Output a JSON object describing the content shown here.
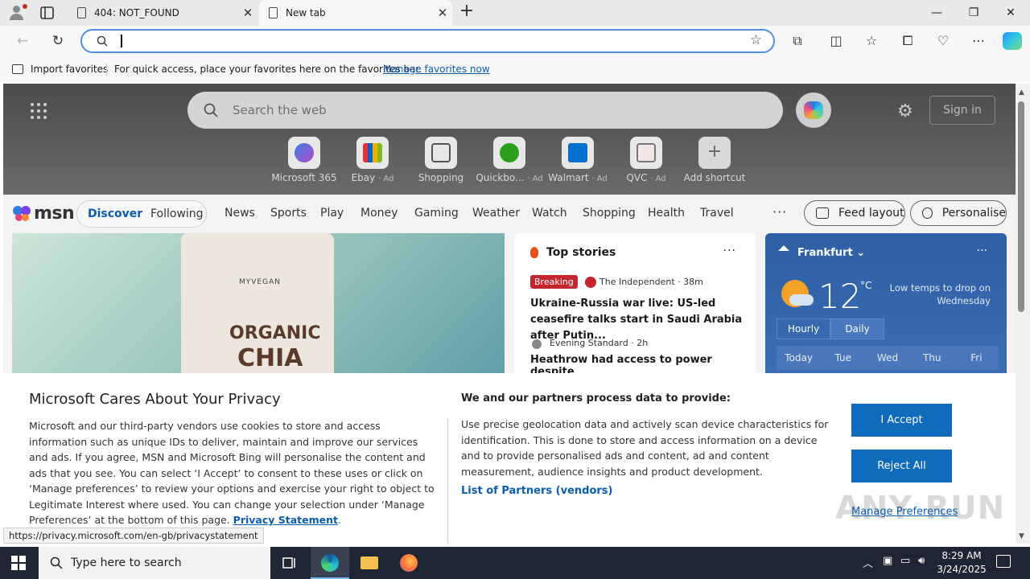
{
  "browser": {
    "tabs": [
      {
        "title": "404: NOT_FOUND",
        "active": false
      },
      {
        "title": "New tab",
        "active": true
      }
    ],
    "address": {
      "value": "",
      "placeholder": ""
    },
    "favorites_bar": {
      "import_label": "Import favorites",
      "hint": "For quick access, place your favorites here on the favorites bar.",
      "manage_link": "Manage favorites now"
    }
  },
  "msn": {
    "search_placeholder": "Search the web",
    "sign_in": "Sign in",
    "shortcuts": [
      {
        "label": "Microsoft 365",
        "ad": ""
      },
      {
        "label": "Ebay",
        "ad": "· Ad"
      },
      {
        "label": "Shopping",
        "ad": ""
      },
      {
        "label": "Quickbo...",
        "ad": "· Ad"
      },
      {
        "label": "Walmart",
        "ad": "· Ad"
      },
      {
        "label": "QVC",
        "ad": "· Ad"
      },
      {
        "label": "Add shortcut",
        "ad": ""
      }
    ],
    "logo": "msn",
    "feed_tabs": {
      "discover": "Discover",
      "following": "Following"
    },
    "nav": [
      "News",
      "Sports",
      "Play",
      "Money",
      "Gaming",
      "Weather",
      "Watch",
      "Shopping",
      "Health",
      "Travel"
    ],
    "more": "···",
    "feed_layout": "Feed layout",
    "personalise": "Personalise",
    "hero_image": {
      "brand": "MYVEGAN",
      "line1": "ORGANIC",
      "line2": "CHIA"
    },
    "top_stories": {
      "heading": "Top stories",
      "more": "···",
      "items": [
        {
          "badge": "Breaking",
          "source": "The Independent · 38m",
          "headline": "Ukraine-Russia war live: US-led ceasefire talks start in Saudi Arabia after Putin..."
        },
        {
          "source": "Evening Standard · 2h",
          "headline": "Heathrow had access to power despite"
        }
      ]
    },
    "weather": {
      "location": "Frankfurt",
      "temp": "12",
      "unit": "°C",
      "note": "Low temps to drop on Wednesday",
      "more": "···",
      "toggle": [
        "Hourly",
        "Daily"
      ],
      "days": [
        "Today",
        "Tue",
        "Wed",
        "Thu",
        "Fri"
      ]
    }
  },
  "privacy": {
    "title": "Microsoft Cares About Your Privacy",
    "body": "Microsoft and our third-party vendors use cookies to store and access information such as unique IDs to deliver, maintain and improve our services and ads. If you agree, MSN and Microsoft Bing will personalise the content and ads that you see. You can select ‘I Accept’ to consent to these uses or click on ‘Manage preferences’ to review your options and exercise your right to object to Legitimate Interest where used.  You can change your selection under ‘Manage Preferences’ at the bottom of this page.",
    "privacy_link": "Privacy Statement",
    "subtitle": "We and our partners process data to provide:",
    "body2": "Use precise geolocation data and actively scan device characteristics for identification. This is done to store and access information on a device and to provide personalised ads and content, ad and content measurement, audience insights and product development.",
    "partners_link": "List of Partners (vendors)",
    "accept": "I Accept",
    "reject": "Reject All",
    "manage": "Manage Preferences"
  },
  "status_url": "https://privacy.microsoft.com/en-gb/privacystatement",
  "watermark": "ANY RUN",
  "taskbar": {
    "search_placeholder": "Type here to search",
    "time": "8:29 AM",
    "date": "3/24/2025"
  }
}
